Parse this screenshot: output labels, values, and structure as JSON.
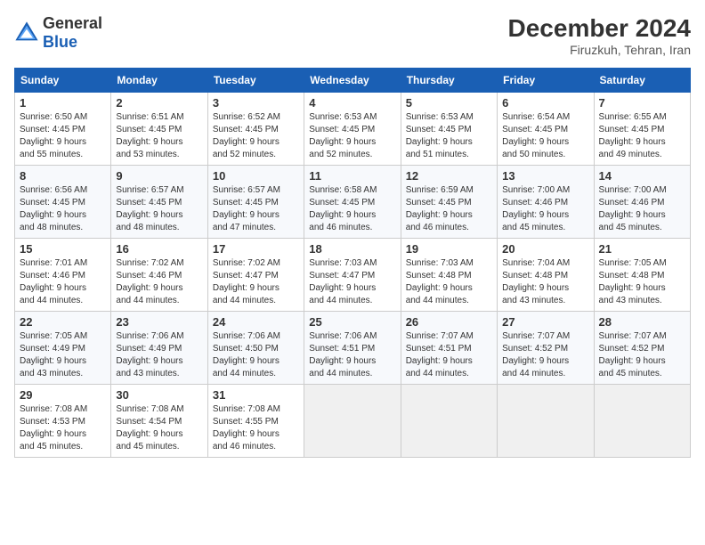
{
  "header": {
    "logo_general": "General",
    "logo_blue": "Blue",
    "month_year": "December 2024",
    "location": "Firuzkuh, Tehran, Iran"
  },
  "days_of_week": [
    "Sunday",
    "Monday",
    "Tuesday",
    "Wednesday",
    "Thursday",
    "Friday",
    "Saturday"
  ],
  "weeks": [
    [
      {
        "day": 1,
        "info": "Sunrise: 6:50 AM\nSunset: 4:45 PM\nDaylight: 9 hours\nand 55 minutes."
      },
      {
        "day": 2,
        "info": "Sunrise: 6:51 AM\nSunset: 4:45 PM\nDaylight: 9 hours\nand 53 minutes."
      },
      {
        "day": 3,
        "info": "Sunrise: 6:52 AM\nSunset: 4:45 PM\nDaylight: 9 hours\nand 52 minutes."
      },
      {
        "day": 4,
        "info": "Sunrise: 6:53 AM\nSunset: 4:45 PM\nDaylight: 9 hours\nand 52 minutes."
      },
      {
        "day": 5,
        "info": "Sunrise: 6:53 AM\nSunset: 4:45 PM\nDaylight: 9 hours\nand 51 minutes."
      },
      {
        "day": 6,
        "info": "Sunrise: 6:54 AM\nSunset: 4:45 PM\nDaylight: 9 hours\nand 50 minutes."
      },
      {
        "day": 7,
        "info": "Sunrise: 6:55 AM\nSunset: 4:45 PM\nDaylight: 9 hours\nand 49 minutes."
      }
    ],
    [
      {
        "day": 8,
        "info": "Sunrise: 6:56 AM\nSunset: 4:45 PM\nDaylight: 9 hours\nand 48 minutes."
      },
      {
        "day": 9,
        "info": "Sunrise: 6:57 AM\nSunset: 4:45 PM\nDaylight: 9 hours\nand 48 minutes."
      },
      {
        "day": 10,
        "info": "Sunrise: 6:57 AM\nSunset: 4:45 PM\nDaylight: 9 hours\nand 47 minutes."
      },
      {
        "day": 11,
        "info": "Sunrise: 6:58 AM\nSunset: 4:45 PM\nDaylight: 9 hours\nand 46 minutes."
      },
      {
        "day": 12,
        "info": "Sunrise: 6:59 AM\nSunset: 4:45 PM\nDaylight: 9 hours\nand 46 minutes."
      },
      {
        "day": 13,
        "info": "Sunrise: 7:00 AM\nSunset: 4:46 PM\nDaylight: 9 hours\nand 45 minutes."
      },
      {
        "day": 14,
        "info": "Sunrise: 7:00 AM\nSunset: 4:46 PM\nDaylight: 9 hours\nand 45 minutes."
      }
    ],
    [
      {
        "day": 15,
        "info": "Sunrise: 7:01 AM\nSunset: 4:46 PM\nDaylight: 9 hours\nand 44 minutes."
      },
      {
        "day": 16,
        "info": "Sunrise: 7:02 AM\nSunset: 4:46 PM\nDaylight: 9 hours\nand 44 minutes."
      },
      {
        "day": 17,
        "info": "Sunrise: 7:02 AM\nSunset: 4:47 PM\nDaylight: 9 hours\nand 44 minutes."
      },
      {
        "day": 18,
        "info": "Sunrise: 7:03 AM\nSunset: 4:47 PM\nDaylight: 9 hours\nand 44 minutes."
      },
      {
        "day": 19,
        "info": "Sunrise: 7:03 AM\nSunset: 4:48 PM\nDaylight: 9 hours\nand 44 minutes."
      },
      {
        "day": 20,
        "info": "Sunrise: 7:04 AM\nSunset: 4:48 PM\nDaylight: 9 hours\nand 43 minutes."
      },
      {
        "day": 21,
        "info": "Sunrise: 7:05 AM\nSunset: 4:48 PM\nDaylight: 9 hours\nand 43 minutes."
      }
    ],
    [
      {
        "day": 22,
        "info": "Sunrise: 7:05 AM\nSunset: 4:49 PM\nDaylight: 9 hours\nand 43 minutes."
      },
      {
        "day": 23,
        "info": "Sunrise: 7:06 AM\nSunset: 4:49 PM\nDaylight: 9 hours\nand 43 minutes."
      },
      {
        "day": 24,
        "info": "Sunrise: 7:06 AM\nSunset: 4:50 PM\nDaylight: 9 hours\nand 44 minutes."
      },
      {
        "day": 25,
        "info": "Sunrise: 7:06 AM\nSunset: 4:51 PM\nDaylight: 9 hours\nand 44 minutes."
      },
      {
        "day": 26,
        "info": "Sunrise: 7:07 AM\nSunset: 4:51 PM\nDaylight: 9 hours\nand 44 minutes."
      },
      {
        "day": 27,
        "info": "Sunrise: 7:07 AM\nSunset: 4:52 PM\nDaylight: 9 hours\nand 44 minutes."
      },
      {
        "day": 28,
        "info": "Sunrise: 7:07 AM\nSunset: 4:52 PM\nDaylight: 9 hours\nand 45 minutes."
      }
    ],
    [
      {
        "day": 29,
        "info": "Sunrise: 7:08 AM\nSunset: 4:53 PM\nDaylight: 9 hours\nand 45 minutes."
      },
      {
        "day": 30,
        "info": "Sunrise: 7:08 AM\nSunset: 4:54 PM\nDaylight: 9 hours\nand 45 minutes."
      },
      {
        "day": 31,
        "info": "Sunrise: 7:08 AM\nSunset: 4:55 PM\nDaylight: 9 hours\nand 46 minutes."
      },
      null,
      null,
      null,
      null
    ]
  ]
}
